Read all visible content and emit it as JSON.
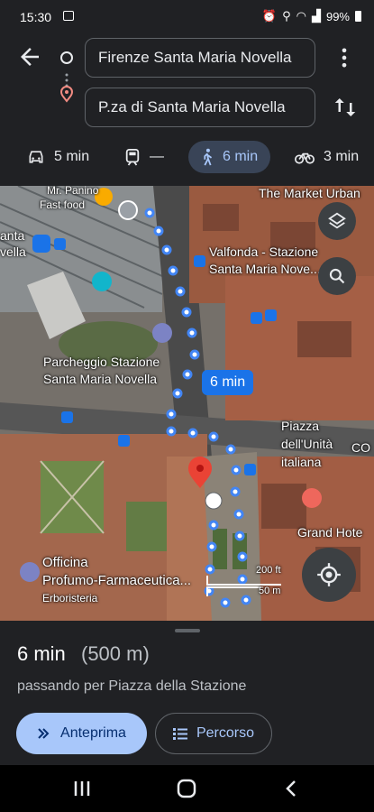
{
  "status_bar": {
    "time": "15:30",
    "battery": "99%"
  },
  "route": {
    "origin": "Firenze Santa Maria Novella",
    "destination": "P.za di Santa Maria Novella"
  },
  "modes": [
    {
      "name": "car",
      "label": "5 min"
    },
    {
      "name": "transit",
      "label": "—"
    },
    {
      "name": "walk",
      "label": "6 min"
    },
    {
      "name": "bike",
      "label": "3 min"
    }
  ],
  "map": {
    "labels": {
      "mercato": "The Market Urban",
      "valfonda": "Valfonda - Stazione\nSanta Maria Nove...",
      "parcheggio": "Parcheggio Stazione\nSanta Maria Novella",
      "piazza": "Piazza\ndell'Unità\nitaliana",
      "grand_hotel": "Grand Hote",
      "officina": "Officina\nProfumo-Farmaceutica...",
      "erboristeria": "Erboristeria",
      "fast_food": "Fast food",
      "farini": "Mr. Panino",
      "santa": "anta\nvella",
      "co": "CO"
    },
    "route_badge": "6 min",
    "scale_ft": "200 ft",
    "scale_m": "50 m"
  },
  "summary": {
    "duration": "6 min",
    "distance": "(500 m)",
    "via": "passando per Piazza della Stazione",
    "preview_button": "Anteprima",
    "steps_button": "Percorso"
  },
  "colors": {
    "accent": "#a8c7fa",
    "route_dot": "#4285f4",
    "pin": "#ea4335"
  }
}
